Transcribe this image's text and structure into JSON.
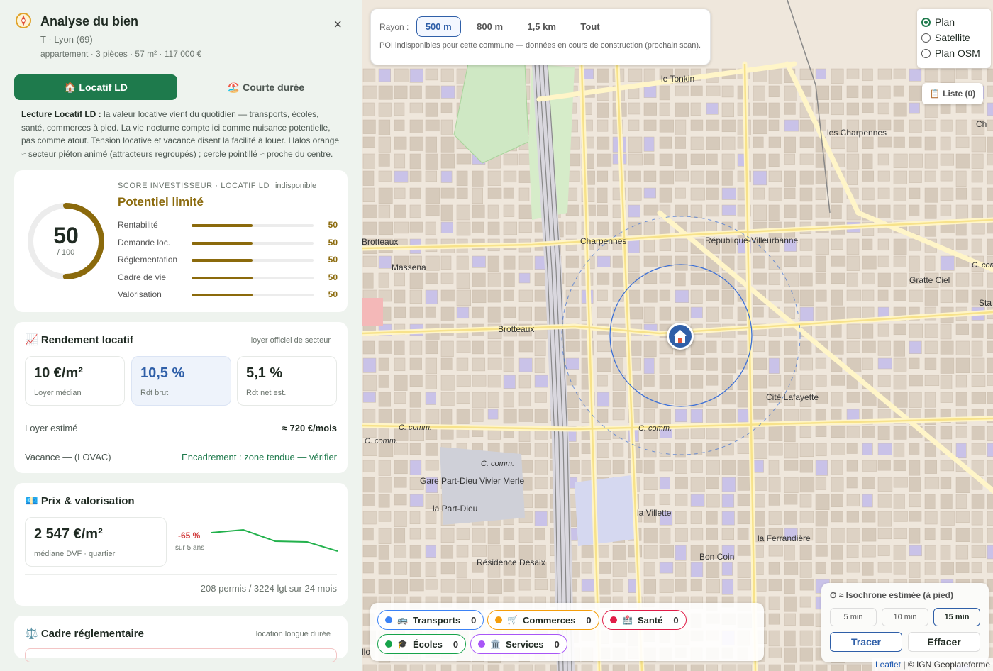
{
  "panel": {
    "title": "Analyse du bien",
    "location": "T · Lyon (69)",
    "details": "appartement · 3 pièces · 57 m² · 117 000 €",
    "close": "×",
    "tabs": [
      {
        "label": "🏠 Locatif LD"
      },
      {
        "label": "🏖️ Courte durée"
      }
    ],
    "lecture_bold": "Lecture Locatif LD :",
    "lecture_text": " la valeur locative vient du quotidien — transports, écoles, santé, commerces à pied. La vie nocturne compte ici comme nuisance potentielle, pas comme atout. Tension locative et vacance disent la facilité à louer. Halos orange ≈ secteur piéton animé (attracteurs regroupés) ; cercle pointillé ≈ proche du centre."
  },
  "score": {
    "label": "SCORE INVESTISSEUR · LOCATIF LD",
    "status": "indisponible",
    "value": "50",
    "denominator": "/ 100",
    "verdict": "Potentiel limité",
    "gauge_fraction": 0.5,
    "criteria": [
      {
        "label": "Rentabilité",
        "value": "50"
      },
      {
        "label": "Demande loc.",
        "value": "50"
      },
      {
        "label": "Réglementation",
        "value": "50"
      },
      {
        "label": "Cadre de vie",
        "value": "50"
      },
      {
        "label": "Valorisation",
        "value": "50"
      }
    ]
  },
  "rendement": {
    "title": "📈 Rendement locatif",
    "source": "loyer officiel de secteur",
    "kpis": [
      {
        "value": "10 €/m²",
        "label": "Loyer médian"
      },
      {
        "value": "10,5 %",
        "label": "Rdt brut"
      },
      {
        "value": "5,1 %",
        "label": "Rdt net est."
      }
    ],
    "loyer_label": "Loyer estimé",
    "loyer_value": "≈ 720 €/mois",
    "vacance_label": "Vacance — (LOVAC)",
    "encadrement": "Encadrement : zone tendue — vérifier"
  },
  "prix": {
    "title": "💶 Prix & valorisation",
    "value": "2 547 €/m²",
    "label": "médiane DVF · quartier",
    "change": "-65 %",
    "change_label": "sur 5 ans",
    "permis": "208 permis / 3224 lgt sur 24 mois"
  },
  "cadre": {
    "title": "⚖️ Cadre réglementaire",
    "subtitle": "location longue durée"
  },
  "map": {
    "rayon_label": "Rayon :",
    "rayon_options": [
      "500 m",
      "800 m",
      "1,5 km",
      "Tout"
    ],
    "rayon_note": "POI indisponibles pour cette commune — données en cours de construction (prochain scan).",
    "layers": [
      "Plan",
      "Satellite",
      "Plan OSM"
    ],
    "liste": "📋 Liste (0)",
    "chips": [
      {
        "label": "Transports",
        "count": "0",
        "color": "#3b82f6",
        "icon": "🚌"
      },
      {
        "label": "Commerces",
        "count": "0",
        "color": "#f59e0b",
        "icon": "🛒"
      },
      {
        "label": "Santé",
        "count": "0",
        "color": "#e11d48",
        "icon": "🏥"
      },
      {
        "label": "Écoles",
        "count": "0",
        "color": "#16a34a",
        "icon": "🎓"
      },
      {
        "label": "Services",
        "count": "0",
        "color": "#a855f7",
        "icon": "🏛️"
      }
    ],
    "iso_title": "⏱ ≈ Isochrone estimée (à pied)",
    "iso_options": [
      "5 min",
      "10 min",
      "15 min"
    ],
    "tracer": "Tracer",
    "effacer": "Effacer",
    "attribution_leaflet": "Leaflet",
    "attribution_rest": " | © IGN Geoplateforme",
    "places": [
      "le Tonkin",
      "les Charpennes",
      "Brotteaux",
      "Massena",
      "Charpennes",
      "République-Villeurbanne",
      "C. com",
      "Gratte Ciel",
      "Sta",
      "Brotteaux",
      "Cité Lafayette",
      "C. comm.",
      "C. comm.",
      "C. comm.",
      "C. comm.",
      "Gare Part-Dieu Vivier Merle",
      "la Part-Dieu",
      "la Villette",
      "la Ferrandière",
      "Bon Coin",
      "Résidence Desaix",
      "Ch",
      "llo"
    ]
  }
}
